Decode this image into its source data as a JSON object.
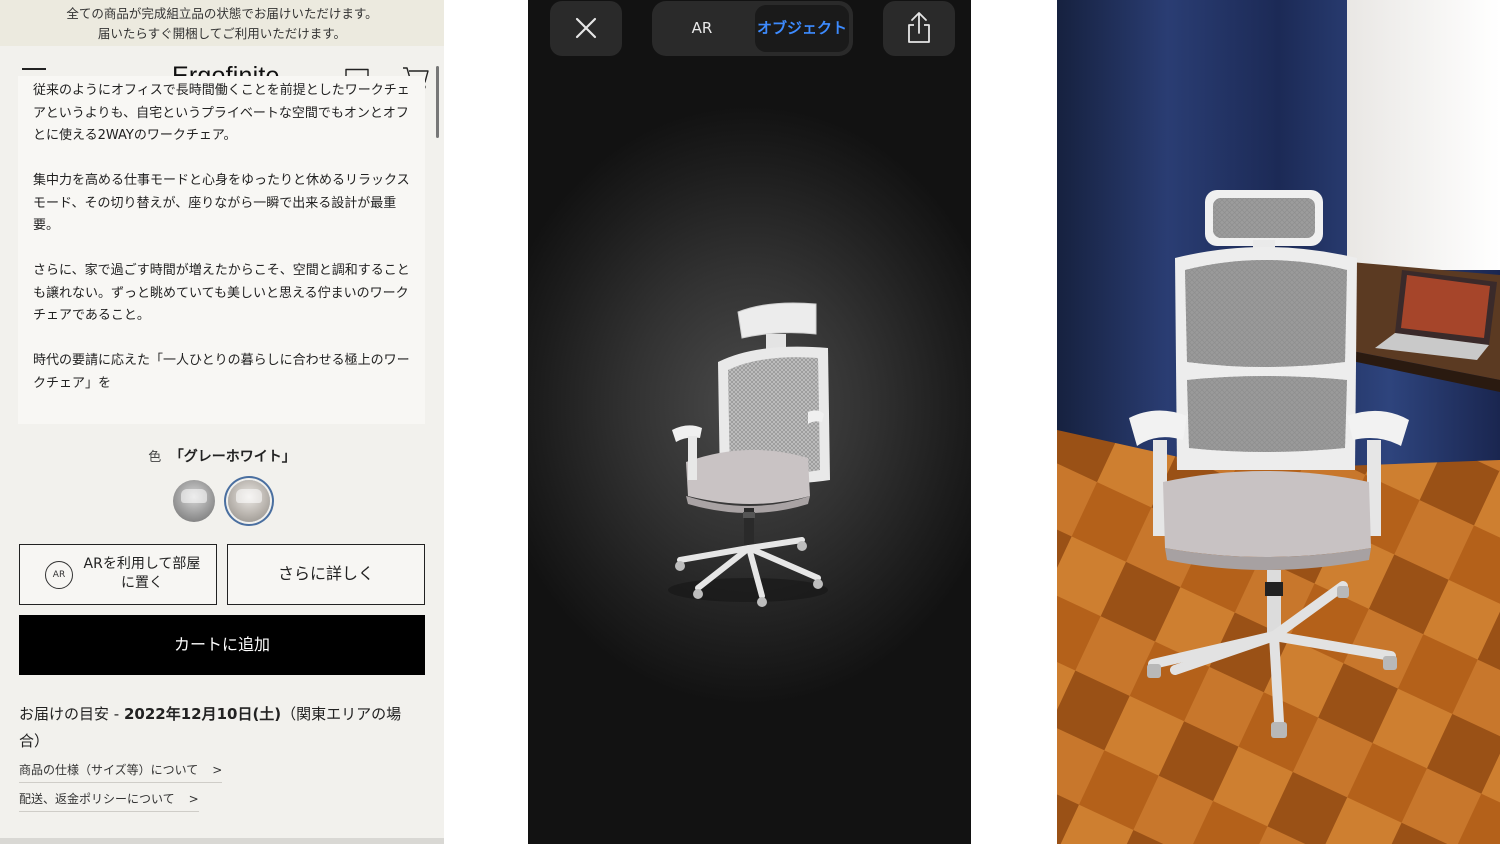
{
  "shop": {
    "banner": {
      "line1": "全ての商品が完成組立品の状態でお届けいただけます。",
      "line2": "届いたらすぐ開梱してご利用いただけます。"
    },
    "header": {
      "logo": "Ergofinite",
      "icons": [
        "menu-icon",
        "chat-icon",
        "cart-icon"
      ]
    },
    "description": [
      "従来のようにオフィスで長時間働くことを前提としたワークチェアというよりも、自宅というプライベートな空間でもオンとオフとに使える2WAYのワークチェア。",
      "集中力を高める仕事モードと心身をゆったりと休めるリラックスモード、その切り替えが、座りながら一瞬で出来る設計が最重要。",
      "さらに、家で過ごす時間が増えたからこそ、空間と調和することも譲れない。ずっと眺めていても美しいと思える佇まいのワークチェアであること。",
      "時代の要請に応えた「一人ひとりの暮らしに合わせる極上のワークチェア」を"
    ],
    "color": {
      "label": "色",
      "value": "「グレーホワイト」",
      "swatches": [
        {
          "name": "gray",
          "selected": false,
          "color": "#8f8f8f"
        },
        {
          "name": "gray-white",
          "selected": true,
          "color": "#c5c0ba"
        }
      ]
    },
    "buttons": {
      "ar_icon_text": "AR",
      "ar_label": "ARを利用して部屋に置く",
      "more_label": "さらに詳しく",
      "cart_label": "カートに追加"
    },
    "delivery": {
      "prefix": "お届けの目安 - ",
      "date": "2022年12月10日(土)",
      "suffix": "（関東エリアの場合）"
    },
    "links": [
      {
        "label": "商品の仕様（サイズ等）について",
        "arrow": ">"
      },
      {
        "label": "配送、返金ポリシーについて",
        "arrow": ">"
      }
    ]
  },
  "viewer": {
    "icons": [
      "close-icon",
      "share-icon"
    ],
    "segments": {
      "ar": "AR",
      "object": "オブジェクト",
      "selected": "object"
    },
    "accent_color": "#3d8bff"
  },
  "ar_view": {
    "content": "chair-placed-in-room"
  },
  "colors": {
    "shop_background": "#f2f1ed",
    "cart_button": "#000000",
    "viewer_background": "#2b2b2b",
    "wall": "#1c2a4e",
    "floor": "#c8711f"
  }
}
